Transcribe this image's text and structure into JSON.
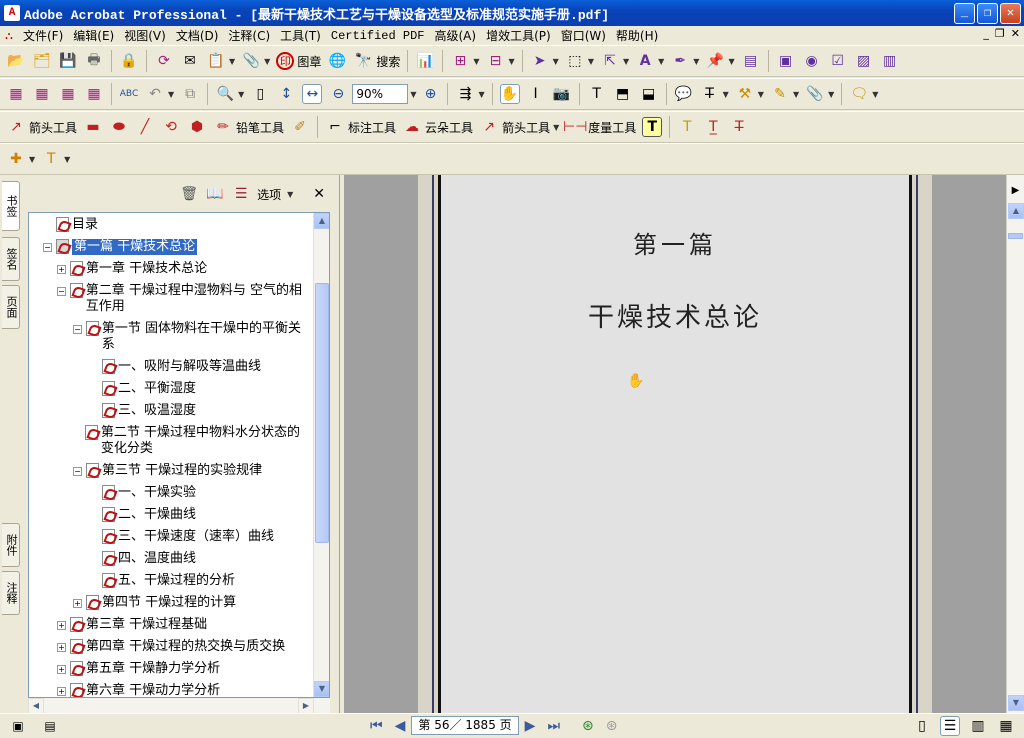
{
  "window": {
    "title": "Adobe Acrobat Professional - [最新干燥技术工艺与干燥设备选型及标准规范实施手册.pdf]",
    "controls": [
      "_",
      "❐",
      "✕"
    ]
  },
  "menu": {
    "items": [
      "文件(F)",
      "编辑(E)",
      "视图(V)",
      "文档(D)",
      "注释(C)",
      "工具(T)",
      "Certified PDF",
      "高级(A)",
      "增效工具(P)",
      "窗口(W)",
      "帮助(H)"
    ]
  },
  "toolbar1": {
    "stamp_label": "图章",
    "search_label": "搜索"
  },
  "toolbar2": {
    "zoom_value": "90%"
  },
  "toolbar3": {
    "arrow_tool": "箭头工具",
    "pencil_tool": "铅笔工具",
    "callout_tool": "标注工具",
    "cloud_tool": "云朵工具",
    "arrow_tool2": "箭头工具",
    "measure_tool": "度量工具"
  },
  "left_tabs": {
    "bookmarks": "书签",
    "signatures": "签名",
    "pages": "页面",
    "attachments": "附件",
    "comments": "注释"
  },
  "panel": {
    "options_label": "选项"
  },
  "bookmarks": [
    {
      "label": "目录",
      "level": 0,
      "expander": ""
    },
    {
      "label": "第一篇 干燥技术总论",
      "level": 0,
      "expander": "−",
      "selected": true
    },
    {
      "label": "第一章 干燥技术总论",
      "level": 1,
      "expander": "+"
    },
    {
      "label": "第二章 干燥过程中湿物料与 空气的相互作用",
      "level": 1,
      "expander": "−"
    },
    {
      "label": "第一节 固体物料在干燥中的平衡关系",
      "level": 2,
      "expander": "−"
    },
    {
      "label": "一、吸附与解吸等温曲线",
      "level": 3,
      "expander": ""
    },
    {
      "label": "二、平衡湿度",
      "level": 3,
      "expander": ""
    },
    {
      "label": "三、吸温湿度",
      "level": 3,
      "expander": ""
    },
    {
      "label": "第二节 干燥过程中物料水分状态的变化分类",
      "level": 2,
      "expander": ""
    },
    {
      "label": "第三节 干燥过程的实验规律",
      "level": 2,
      "expander": "−"
    },
    {
      "label": "一、干燥实验",
      "level": 3,
      "expander": ""
    },
    {
      "label": "二、干燥曲线",
      "level": 3,
      "expander": ""
    },
    {
      "label": "三、干燥速度（速率）曲线",
      "level": 3,
      "expander": ""
    },
    {
      "label": "四、温度曲线",
      "level": 3,
      "expander": ""
    },
    {
      "label": "五、干燥过程的分析",
      "level": 3,
      "expander": ""
    },
    {
      "label": "第四节 干燥过程的计算",
      "level": 2,
      "expander": "+"
    },
    {
      "label": "第三章 干燥过程基础",
      "level": 1,
      "expander": "+"
    },
    {
      "label": "第四章 干燥过程的热交换与质交换",
      "level": 1,
      "expander": "+"
    },
    {
      "label": "第五章 干燥静力学分析",
      "level": 1,
      "expander": "+"
    },
    {
      "label": "第六章 干燥动力学分析",
      "level": 1,
      "expander": "+"
    }
  ],
  "document": {
    "part_title": "第一篇",
    "part_subtitle": "干燥技术总论"
  },
  "status": {
    "page_indicator": "第 56／ 1885 页"
  }
}
